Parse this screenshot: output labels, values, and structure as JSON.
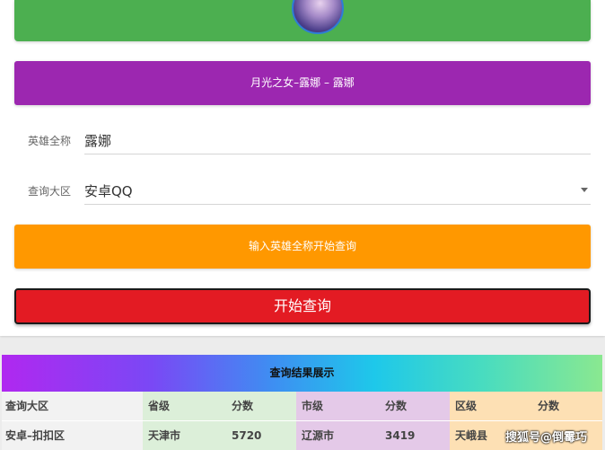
{
  "hero_banner": {
    "title": "月光之女–露娜 – 露娜"
  },
  "form": {
    "hero_name_label": "英雄全称",
    "hero_name_value": "露娜",
    "region_label": "查询大区",
    "region_value": "安卓QQ"
  },
  "hint": {
    "text": "输入英雄全称开始查询"
  },
  "query_button": {
    "label": "开始查询"
  },
  "results": {
    "title": "查询结果展示",
    "headers": {
      "region": "查询大区",
      "province": "省级",
      "province_score": "分数",
      "city": "市级",
      "city_score": "分数",
      "district": "区级",
      "district_score": "分数"
    },
    "row": {
      "region": "安卓–扣扣区",
      "province": "天津市",
      "province_score": "5720",
      "city": "辽源市",
      "city_score": "3419",
      "district": "天峨县"
    }
  },
  "watermark": {
    "text": "搜狐号@倒霉巧"
  },
  "colors": {
    "green": "#4caf50",
    "purple": "#9c27b0",
    "orange": "#ff9800",
    "red": "#e31b23"
  }
}
